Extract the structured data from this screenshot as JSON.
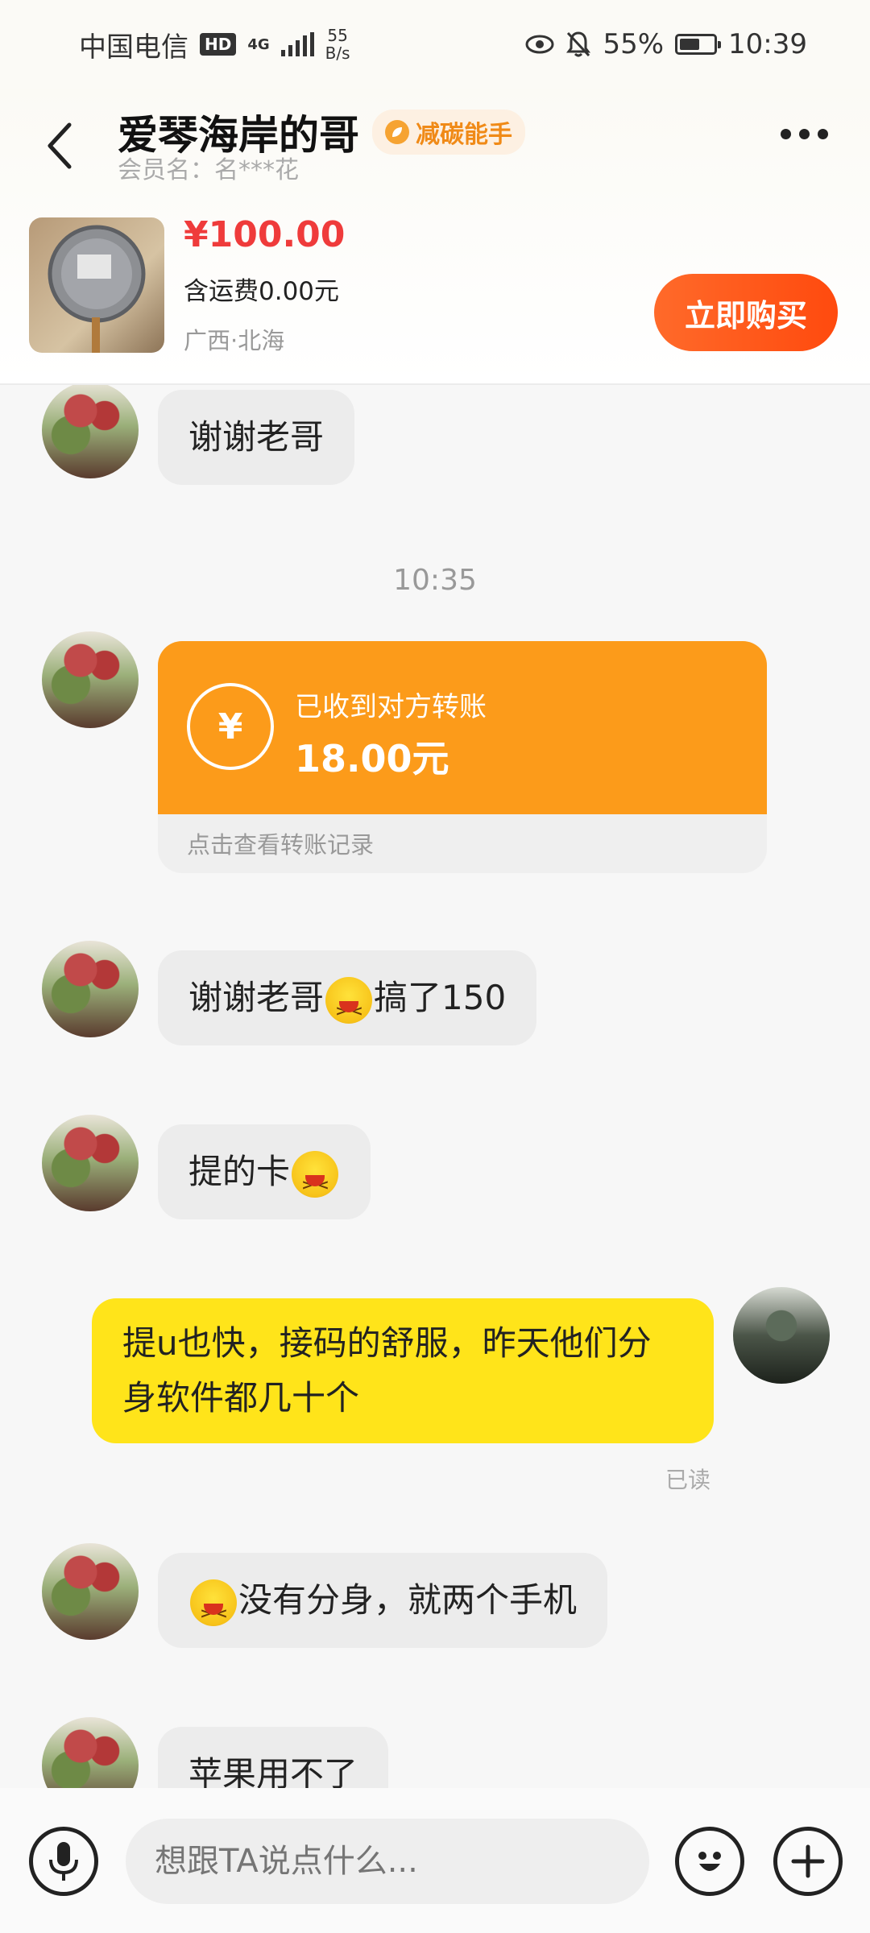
{
  "status_bar": {
    "carrier": "中国电信",
    "hd": "HD",
    "network": "4G",
    "speed": "55\nB/s",
    "battery": "55%",
    "time": "10:39"
  },
  "header": {
    "title": "爱琴海岸的哥",
    "badge": "减碳能手",
    "subtitle": "会员名：名***花",
    "price": "¥100.00",
    "shipping": "含运费0.00元",
    "location": "广西·北海",
    "buy_label": "立即购买"
  },
  "chat": {
    "msg1": "谢谢老哥",
    "timestamp": "10:35",
    "transfer": {
      "label": "已收到对方转账",
      "amount": "18.00元",
      "note": "点击查看转账记录",
      "icon": "¥"
    },
    "msg2_a": "谢谢老哥",
    "msg2_b": "搞了150",
    "msg3": "提的卡",
    "msg4": "提u也快，接码的舒服，昨天他们分身软件都几十个",
    "read": "已读",
    "msg5": "没有分身，就两个手机",
    "msg6": "苹果用不了"
  },
  "input": {
    "placeholder": "想跟TA说点什么..."
  }
}
